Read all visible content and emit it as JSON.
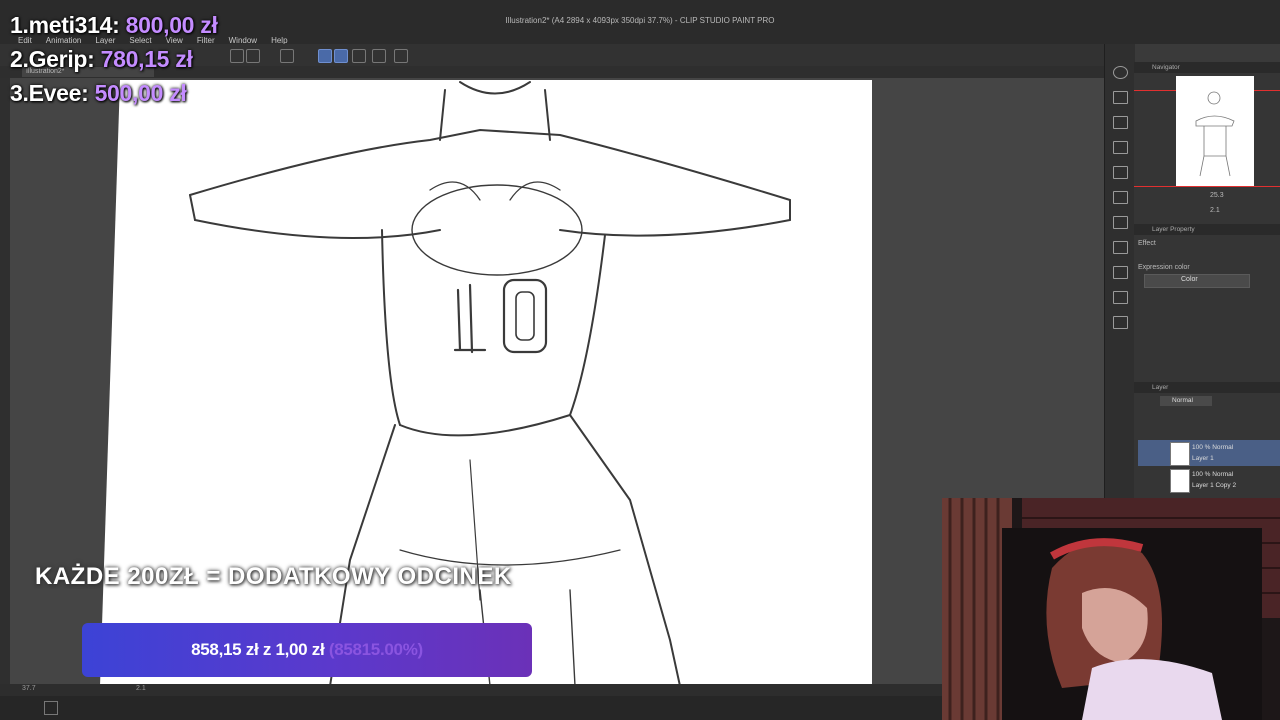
{
  "app": {
    "title": "Illustration2* (A4 2894 x 4093px 350dpi 37.7%) - CLIP STUDIO PAINT PRO",
    "menu": [
      "Edit",
      "Animation",
      "Layer",
      "Select",
      "View",
      "Filter",
      "Window",
      "Help"
    ],
    "canvas_tab": "Illustration2*"
  },
  "canvas": {
    "jersey_number": "10",
    "zoom": "37.7",
    "angle": "2.1"
  },
  "right_panel": {
    "navigator_title": "Navigator",
    "nav_zoom": "25.3",
    "nav_angle": "2.1",
    "layer_property_title": "Layer Property",
    "effect_label": "Effect",
    "expression_color_label": "Expression color",
    "expression_color_value": "Color",
    "layer_title": "Layer",
    "blend_mode": "Normal",
    "layers": [
      {
        "mode": "100 % Normal",
        "name": "Layer 1"
      },
      {
        "mode": "100 % Normal",
        "name": "Layer 1 Copy 2"
      }
    ]
  },
  "overlay": {
    "leaderboard": [
      {
        "rank": "1.",
        "name": "meti314:",
        "amount": "800,00 zł"
      },
      {
        "rank": "2.",
        "name": "Gerip:",
        "amount": "780,15 zł"
      },
      {
        "rank": "3.",
        "name": "Evee:",
        "amount": "500,00 zł"
      }
    ],
    "banner": "KAŻDE 200ZŁ = DODATKOWY ODCINEK",
    "goal": {
      "current": "858,15 zł",
      "separator": "z",
      "target": "1,00 zł",
      "percent": "(85815.00%)",
      "progress": 1.0
    }
  },
  "colors": {
    "accent": "#c48cff",
    "goal_start": "#3c43d6",
    "goal_end": "#6b31b8"
  }
}
